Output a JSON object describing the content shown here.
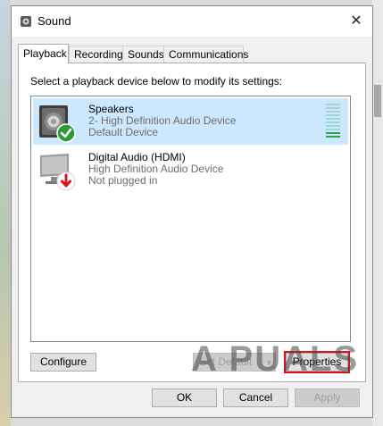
{
  "window": {
    "title": "Sound",
    "close_glyph": "✕"
  },
  "tabs": [
    {
      "label": "Playback",
      "active": true
    },
    {
      "label": "Recording",
      "active": false
    },
    {
      "label": "Sounds",
      "active": false
    },
    {
      "label": "Communications",
      "active": false
    }
  ],
  "instruction": "Select a playback device below to modify its settings:",
  "devices": [
    {
      "name": "Speakers",
      "description": "2- High Definition Audio Device",
      "status": "Default Device",
      "icon": "speaker-icon",
      "badge": "default-check-icon",
      "selected": true
    },
    {
      "name": "Digital Audio (HDMI)",
      "description": "High Definition Audio Device",
      "status": "Not plugged in",
      "icon": "monitor-icon",
      "badge": "unplugged-arrow-icon",
      "selected": false
    }
  ],
  "level_meter": {
    "segments": 10,
    "lit": 2,
    "color_on": "#31a24c"
  },
  "buttons": {
    "configure": "Configure",
    "set_default": "Set Default",
    "properties": "Properties",
    "ok": "OK",
    "cancel": "Cancel",
    "apply": "Apply"
  },
  "watermark": "A  PUALS",
  "colors": {
    "selection": "#cce8ff",
    "highlight": "#e0101a",
    "accent_check": "#2d9b3a"
  }
}
